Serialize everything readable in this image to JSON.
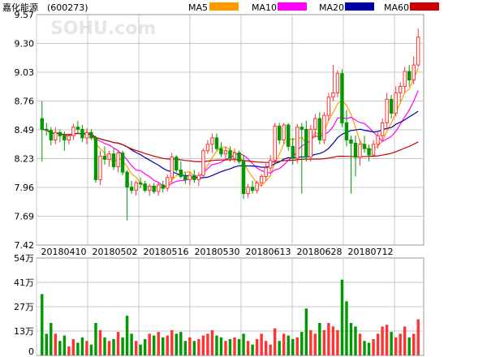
{
  "chart_data": {
    "type": "candlestick",
    "title": "嘉化能源",
    "code": "(600273)",
    "watermark": "SOHU.com",
    "price_axis": {
      "min": 7.42,
      "max": 9.57,
      "ticks": [
        "9.57",
        "9.30",
        "9.03",
        "8.76",
        "8.49",
        "8.23",
        "7.96",
        "7.69",
        "7.42"
      ]
    },
    "volume_axis": {
      "min": 0,
      "max": 54,
      "unit": "万",
      "ticks": [
        "54万",
        "41万",
        "27万",
        "13万",
        "0"
      ]
    },
    "x_labels": [
      "20180410",
      "20180502",
      "20180516",
      "20180530",
      "20180613",
      "20180628",
      "20180712"
    ],
    "legend": [
      {
        "name": "MA5",
        "color": "#ff9900"
      },
      {
        "name": "MA10",
        "color": "#ff00ff"
      },
      {
        "name": "MA20",
        "color": "#0000aa"
      },
      {
        "name": "MA60",
        "color": "#cc0000"
      }
    ],
    "colors": {
      "up": "#ff3333",
      "down": "#009900",
      "grid": "#c8c8c8"
    },
    "candles": [
      [
        8.6,
        8.76,
        8.2,
        8.5,
        34
      ],
      [
        8.5,
        8.56,
        8.44,
        8.49,
        12
      ],
      [
        8.49,
        8.52,
        8.35,
        8.4,
        18
      ],
      [
        8.4,
        8.52,
        8.36,
        8.47,
        12
      ],
      [
        8.47,
        8.5,
        8.38,
        8.44,
        8
      ],
      [
        8.44,
        8.48,
        8.3,
        8.4,
        11
      ],
      [
        8.4,
        8.46,
        8.36,
        8.44,
        5
      ],
      [
        8.44,
        8.55,
        8.4,
        8.52,
        9
      ],
      [
        8.52,
        8.58,
        8.46,
        8.5,
        7
      ],
      [
        8.5,
        8.54,
        8.38,
        8.42,
        10
      ],
      [
        8.42,
        8.51,
        8.36,
        8.47,
        8
      ],
      [
        8.47,
        8.5,
        8.4,
        8.42,
        6
      ],
      [
        8.42,
        8.44,
        8.0,
        8.03,
        18
      ],
      [
        8.03,
        8.3,
        7.98,
        8.25,
        14
      ],
      [
        8.25,
        8.34,
        8.17,
        8.22,
        10
      ],
      [
        8.22,
        8.3,
        8.15,
        8.27,
        8
      ],
      [
        8.27,
        8.32,
        8.12,
        8.15,
        9
      ],
      [
        8.15,
        8.3,
        8.1,
        8.28,
        13
      ],
      [
        8.28,
        8.3,
        8.07,
        8.1,
        10
      ],
      [
        8.1,
        8.12,
        7.65,
        7.96,
        22
      ],
      [
        7.96,
        8.02,
        7.9,
        7.93,
        12
      ],
      [
        7.93,
        8.02,
        7.88,
        8.0,
        8
      ],
      [
        8.0,
        8.05,
        7.95,
        7.99,
        6
      ],
      [
        7.99,
        8.02,
        7.91,
        7.93,
        9
      ],
      [
        7.93,
        7.99,
        7.88,
        7.97,
        12
      ],
      [
        7.97,
        8.0,
        7.9,
        7.92,
        11
      ],
      [
        7.92,
        8.0,
        7.88,
        7.98,
        13
      ],
      [
        7.98,
        8.02,
        7.91,
        7.95,
        10
      ],
      [
        7.95,
        8.08,
        7.92,
        8.05,
        11
      ],
      [
        8.05,
        8.28,
        8.0,
        8.24,
        14
      ],
      [
        8.24,
        8.26,
        8.1,
        8.12,
        12
      ],
      [
        8.12,
        8.2,
        8.04,
        8.06,
        13
      ],
      [
        8.06,
        8.1,
        7.99,
        8.03,
        8
      ],
      [
        8.03,
        8.1,
        7.98,
        8.07,
        10
      ],
      [
        8.07,
        8.12,
        8.0,
        8.03,
        8
      ],
      [
        8.03,
        8.1,
        7.97,
        8.07,
        9
      ],
      [
        8.07,
        8.32,
        8.05,
        8.3,
        11
      ],
      [
        8.3,
        8.4,
        8.27,
        8.36,
        12
      ],
      [
        8.36,
        8.46,
        8.28,
        8.42,
        14
      ],
      [
        8.42,
        8.46,
        8.3,
        8.32,
        11
      ],
      [
        8.32,
        8.38,
        8.24,
        8.27,
        10
      ],
      [
        8.27,
        8.34,
        8.22,
        8.3,
        8
      ],
      [
        8.3,
        8.34,
        8.2,
        8.23,
        9
      ],
      [
        8.23,
        8.32,
        8.19,
        8.28,
        10
      ],
      [
        8.28,
        8.3,
        8.18,
        8.2,
        9
      ],
      [
        8.2,
        8.26,
        7.85,
        7.9,
        12
      ],
      [
        7.9,
        7.99,
        7.86,
        7.96,
        8
      ],
      [
        7.96,
        8.02,
        7.9,
        7.93,
        6
      ],
      [
        7.93,
        8.02,
        7.9,
        8.0,
        9
      ],
      [
        8.0,
        8.08,
        7.97,
        8.06,
        12
      ],
      [
        8.06,
        8.18,
        8.02,
        8.14,
        8
      ],
      [
        8.14,
        8.26,
        8.1,
        8.21,
        6
      ],
      [
        8.21,
        8.56,
        8.18,
        8.53,
        15
      ],
      [
        8.53,
        8.56,
        8.36,
        8.4,
        8
      ],
      [
        8.4,
        8.56,
        8.36,
        8.54,
        12
      ],
      [
        8.54,
        8.56,
        8.3,
        8.34,
        11
      ],
      [
        8.34,
        8.42,
        8.17,
        8.23,
        9
      ],
      [
        8.23,
        8.55,
        8.18,
        8.52,
        10
      ],
      [
        8.52,
        8.56,
        7.9,
        8.5,
        13
      ],
      [
        8.5,
        8.58,
        8.2,
        8.24,
        26
      ],
      [
        8.24,
        8.54,
        8.2,
        8.5,
        14
      ],
      [
        8.5,
        8.64,
        8.42,
        8.6,
        12
      ],
      [
        8.6,
        8.66,
        8.36,
        8.4,
        18
      ],
      [
        8.4,
        8.66,
        8.36,
        8.63,
        14
      ],
      [
        8.63,
        8.84,
        8.58,
        8.8,
        18
      ],
      [
        8.8,
        9.1,
        8.76,
        8.84,
        16
      ],
      [
        8.84,
        9.05,
        8.8,
        9.02,
        14
      ],
      [
        9.02,
        9.06,
        8.52,
        8.56,
        42
      ],
      [
        8.56,
        8.68,
        8.34,
        8.4,
        30
      ],
      [
        8.4,
        8.44,
        7.9,
        8.37,
        18
      ],
      [
        8.37,
        8.44,
        8.06,
        8.24,
        16
      ],
      [
        8.24,
        8.4,
        8.16,
        8.36,
        12
      ],
      [
        8.36,
        8.44,
        8.28,
        8.32,
        8
      ],
      [
        8.32,
        8.36,
        8.2,
        8.26,
        7
      ],
      [
        8.26,
        8.4,
        8.24,
        8.36,
        9
      ],
      [
        8.36,
        8.48,
        8.32,
        8.44,
        12
      ],
      [
        8.44,
        8.6,
        8.4,
        8.56,
        16
      ],
      [
        8.56,
        8.84,
        8.5,
        8.78,
        17
      ],
      [
        8.78,
        8.82,
        8.6,
        8.65,
        13
      ],
      [
        8.65,
        8.9,
        8.62,
        8.84,
        10
      ],
      [
        8.84,
        8.94,
        8.76,
        8.9,
        12
      ],
      [
        8.9,
        9.08,
        8.84,
        9.04,
        16
      ],
      [
        9.04,
        9.1,
        8.9,
        8.96,
        10
      ],
      [
        8.96,
        9.18,
        8.92,
        9.1,
        12
      ],
      [
        9.1,
        9.44,
        9.08,
        9.36,
        20
      ]
    ]
  }
}
